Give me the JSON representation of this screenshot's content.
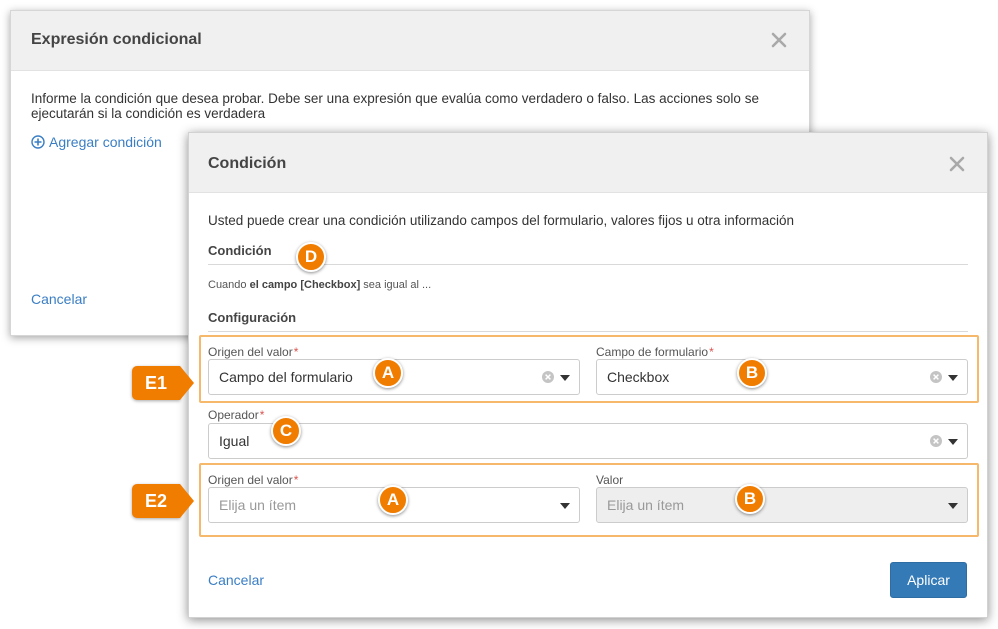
{
  "back_modal": {
    "title": "Expresión condicional",
    "description": "Informe la condición que desea probar. Debe ser una expresión que evalúa como verdadero o falso. Las acciones solo se ejecutarán si la condición es verdadera",
    "add_condition_label": "Agregar condición",
    "cancel_label": "Cancelar"
  },
  "front_modal": {
    "title": "Condición",
    "intro": "Usted puede crear una condición utilizando campos del formulario, valores fijos u otra información",
    "condition_section_title": "Condición",
    "condition_text": {
      "prefix": "Cuando ",
      "bold": "el campo [Checkbox]",
      "suffix": " sea igual al ..."
    },
    "config_section_title": "Configuración",
    "row1": {
      "left_label": "Origen del valor",
      "left_value": "Campo del formulario",
      "right_label": "Campo de formulario",
      "right_value": "Checkbox"
    },
    "operator": {
      "label": "Operador",
      "value": "Igual"
    },
    "row2": {
      "left_label": "Origen del valor",
      "left_placeholder": "Elija un ítem",
      "right_label": "Valor",
      "right_placeholder": "Elija un ítem"
    },
    "required_mark": "*",
    "cancel_label": "Cancelar",
    "apply_label": "Aplicar"
  },
  "annotations": {
    "e1": "E1",
    "e2": "E2",
    "a": "A",
    "b": "B",
    "c": "C",
    "d": "D"
  },
  "colors": {
    "accent_orange": "#f07c00",
    "highlight_border": "#f6b86b",
    "link_blue": "#3a7ec4",
    "primary_button": "#337ab7",
    "required_red": "#d9534f"
  },
  "icons": {
    "close": "close-icon",
    "add": "plus-circle-icon",
    "clear": "clear-circle-icon",
    "dropdown": "caret-down-icon"
  }
}
